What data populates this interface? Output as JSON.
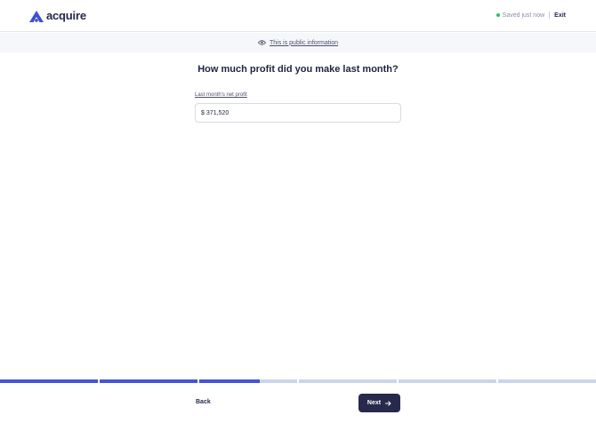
{
  "header": {
    "logo_text": "acquire",
    "saved_text": "Saved just now",
    "exit_label": "Exit",
    "saved_color": "#2fbf5f",
    "brand_color": "#3d4ed6"
  },
  "banner": {
    "icon": "eye-icon",
    "text": "This is public information"
  },
  "main": {
    "question": "How much profit did you make last month?",
    "field_label": "Last month's net profit",
    "currency": "$",
    "value": "371,520"
  },
  "progress": {
    "segments": [
      1,
      1,
      0.62,
      0,
      0,
      0
    ],
    "fill_color": "#4554d8",
    "track_color": "#c8d6ec"
  },
  "footer": {
    "back_label": "Back",
    "next_label": "Next"
  }
}
